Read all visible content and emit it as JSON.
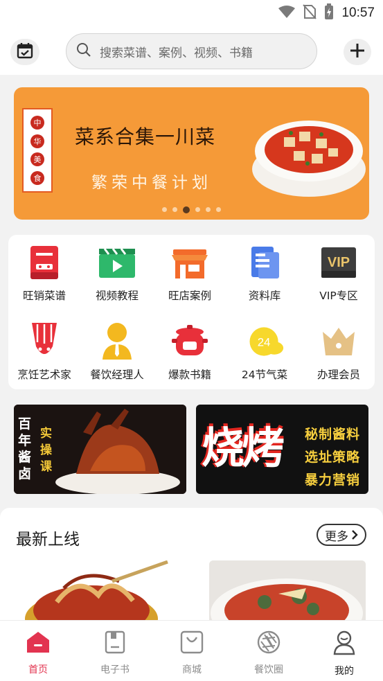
{
  "status_bar": {
    "time": "10:57",
    "icons": [
      "wifi-icon",
      "no-sim-icon",
      "battery-charging-icon"
    ]
  },
  "header": {
    "calendar_icon": "calendar-check-icon",
    "search_placeholder": "搜索菜谱、案例、视频、书籍",
    "add_icon": "plus-icon"
  },
  "banner": {
    "seal_chars": [
      "中",
      "华",
      "美",
      "食"
    ],
    "title": "菜系合集一川菜",
    "subtitle": "繁荣中餐计划",
    "dot_count": 6,
    "active_dot": 3
  },
  "features": [
    {
      "label": "旺销菜谱",
      "icon": "red-book-icon"
    },
    {
      "label": "视频教程",
      "icon": "video-clapper-icon"
    },
    {
      "label": "旺店案例",
      "icon": "storefront-icon"
    },
    {
      "label": "资料库",
      "icon": "document-library-icon"
    },
    {
      "label": "VIP专区",
      "icon": "vip-badge-icon"
    },
    {
      "label": "烹饪艺术家",
      "icon": "chef-hat-icon"
    },
    {
      "label": "餐饮经理人",
      "icon": "manager-person-icon"
    },
    {
      "label": "爆款书籍",
      "icon": "cooking-pot-icon"
    },
    {
      "label": "24节气菜",
      "icon": "solar-terms-cloud-icon"
    },
    {
      "label": "办理会员",
      "icon": "crown-icon"
    }
  ],
  "feature_badges": {
    "vip": "VIP",
    "solar_terms": "24"
  },
  "promos": {
    "left": {
      "vertical_white": "百年酱卤",
      "vertical_gold": "实操课"
    },
    "right": {
      "big_text": "烧烤",
      "lines": [
        "秘制酱料",
        "选址策略",
        "暴力营销"
      ]
    }
  },
  "latest": {
    "title": "最新上线",
    "more_label": "更多"
  },
  "tabs": [
    {
      "label": "首页",
      "icon": "home-icon",
      "active": true
    },
    {
      "label": "电子书",
      "icon": "ebook-icon",
      "active": false
    },
    {
      "label": "商城",
      "icon": "shopping-bag-icon",
      "active": false
    },
    {
      "label": "餐饮圈",
      "icon": "aperture-icon",
      "active": false
    },
    {
      "label": "我的",
      "icon": "user-icon",
      "active": false
    }
  ],
  "colors": {
    "accent": "#e23450",
    "banner_bg": "#f59a38",
    "promo_gold": "#f6ce3e"
  }
}
